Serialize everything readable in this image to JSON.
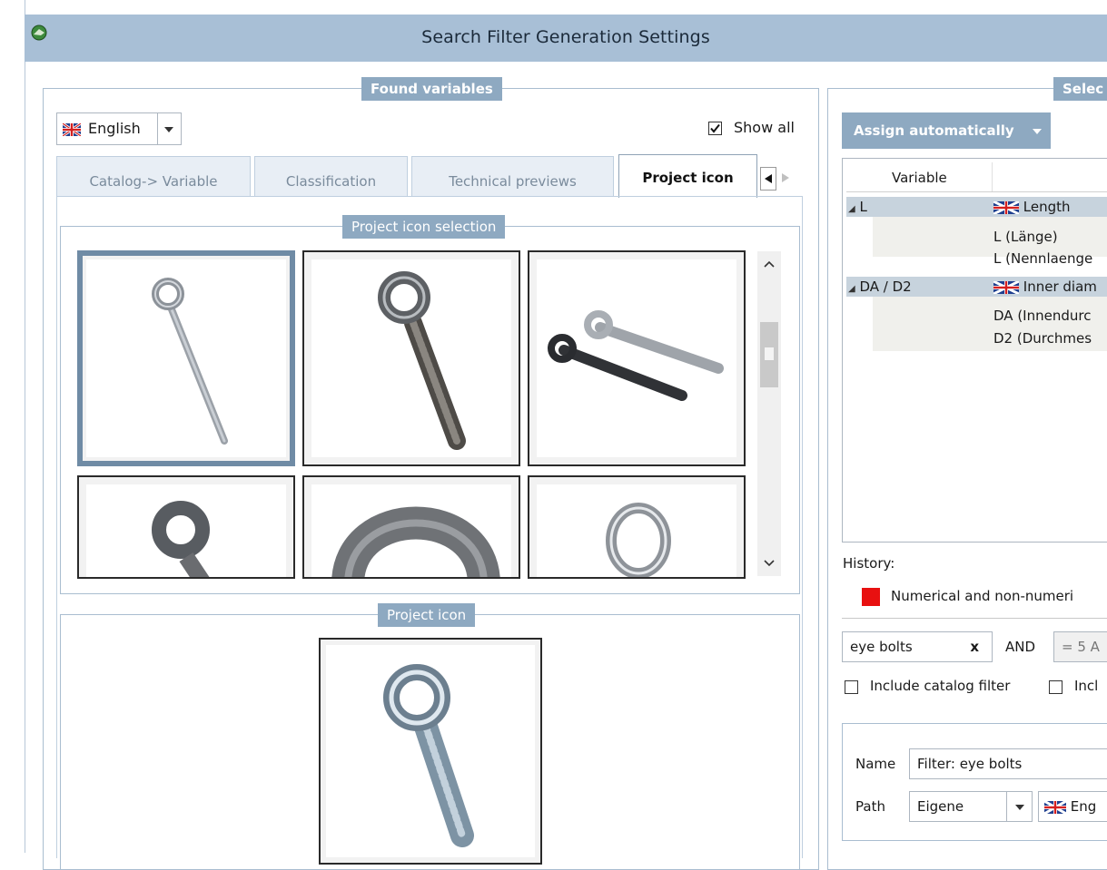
{
  "window": {
    "title": "Search Filter Generation Settings"
  },
  "found_variables": {
    "title": "Found variables",
    "language": "English",
    "show_all_label": "Show all",
    "show_all_checked": true,
    "tabs": [
      {
        "label": "Catalog-> Variable",
        "active": false
      },
      {
        "label": "Classification",
        "active": false
      },
      {
        "label": "Technical previews",
        "active": false
      },
      {
        "label": "Project icon",
        "active": true
      }
    ],
    "icon_selection_title": "Project icon selection",
    "project_icon_title": "Project icon"
  },
  "right_panel": {
    "title": "Selec",
    "assign_button": "Assign automatically",
    "table_header": "Variable",
    "tree": [
      {
        "name": "L",
        "flag": true,
        "value": "Length",
        "children": [
          "L (Länge)",
          "L (Nennlaenge"
        ]
      },
      {
        "name": "DA / D2",
        "flag": true,
        "value": "Inner diam",
        "children": [
          "DA (Innendurc",
          "D2 (Durchmes"
        ]
      }
    ],
    "history_label": "History:",
    "history_item": "Numerical and non-numeri",
    "history_color": "#e81010",
    "search_term": "eye bolts",
    "clear_symbol": "x",
    "and_label": "AND",
    "condition": "= 5 A",
    "include_catalog_filter": "Include catalog filter",
    "include_other": "Incl",
    "name_label": "Name",
    "name_value": "Filter: eye bolts",
    "path_label": "Path",
    "path_value": "Eigene",
    "path_language": "Eng"
  }
}
